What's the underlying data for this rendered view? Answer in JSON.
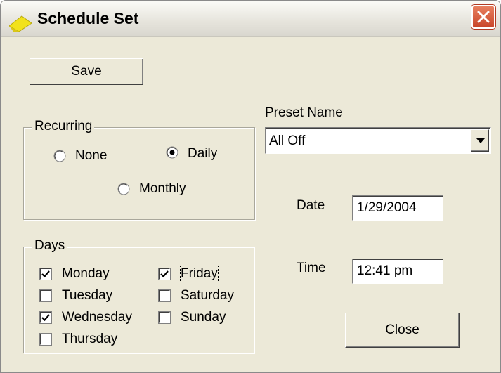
{
  "window": {
    "title": "Schedule Set",
    "close_glyph": "×"
  },
  "buttons": {
    "save": "Save",
    "close": "Close"
  },
  "recurring": {
    "legend": "Recurring",
    "options": [
      {
        "label": "None",
        "selected": false
      },
      {
        "label": "Daily",
        "selected": true
      },
      {
        "label": "Monthly",
        "selected": false
      }
    ]
  },
  "days": {
    "legend": "Days",
    "items": [
      {
        "label": "Monday",
        "checked": true
      },
      {
        "label": "Tuesday",
        "checked": false
      },
      {
        "label": "Wednesday",
        "checked": true
      },
      {
        "label": "Thursday",
        "checked": false
      },
      {
        "label": "Friday",
        "checked": true
      },
      {
        "label": "Saturday",
        "checked": false
      },
      {
        "label": "Sunday",
        "checked": false
      }
    ]
  },
  "preset": {
    "label": "Preset Name",
    "value": "All Off"
  },
  "date": {
    "label": "Date",
    "value": "1/29/2004"
  },
  "time": {
    "label": "Time",
    "value": "12:41 pm"
  },
  "icons": {
    "title": "folder-arrow-icon",
    "dropdown": "chevron-down-icon",
    "radio": "radio-icon",
    "checkbox": "checkbox-icon"
  },
  "colors": {
    "face": "#ece9d8",
    "close_button": "#c8452a",
    "title_icon": "#f2e21c"
  }
}
